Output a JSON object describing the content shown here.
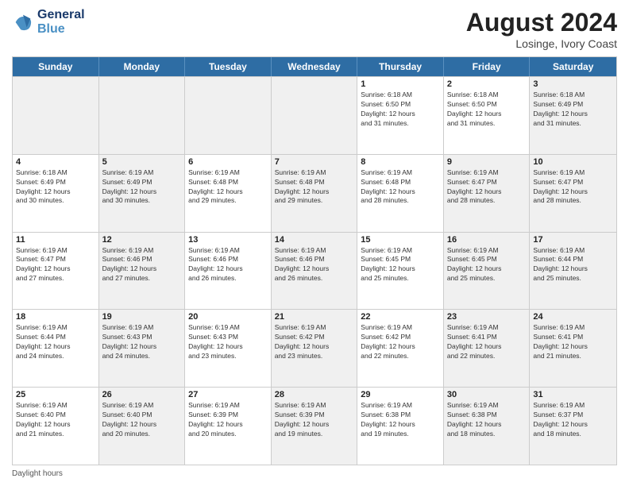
{
  "header": {
    "logo_line1": "General",
    "logo_line2": "Blue",
    "month_year": "August 2024",
    "location": "Losinge, Ivory Coast"
  },
  "weekdays": [
    "Sunday",
    "Monday",
    "Tuesday",
    "Wednesday",
    "Thursday",
    "Friday",
    "Saturday"
  ],
  "rows": [
    [
      {
        "day": "",
        "info": "",
        "shaded": true
      },
      {
        "day": "",
        "info": "",
        "shaded": true
      },
      {
        "day": "",
        "info": "",
        "shaded": true
      },
      {
        "day": "",
        "info": "",
        "shaded": true
      },
      {
        "day": "1",
        "info": "Sunrise: 6:18 AM\nSunset: 6:50 PM\nDaylight: 12 hours\nand 31 minutes."
      },
      {
        "day": "2",
        "info": "Sunrise: 6:18 AM\nSunset: 6:50 PM\nDaylight: 12 hours\nand 31 minutes."
      },
      {
        "day": "3",
        "info": "Sunrise: 6:18 AM\nSunset: 6:49 PM\nDaylight: 12 hours\nand 31 minutes.",
        "shaded": true
      }
    ],
    [
      {
        "day": "4",
        "info": "Sunrise: 6:18 AM\nSunset: 6:49 PM\nDaylight: 12 hours\nand 30 minutes."
      },
      {
        "day": "5",
        "info": "Sunrise: 6:19 AM\nSunset: 6:49 PM\nDaylight: 12 hours\nand 30 minutes.",
        "shaded": true
      },
      {
        "day": "6",
        "info": "Sunrise: 6:19 AM\nSunset: 6:48 PM\nDaylight: 12 hours\nand 29 minutes."
      },
      {
        "day": "7",
        "info": "Sunrise: 6:19 AM\nSunset: 6:48 PM\nDaylight: 12 hours\nand 29 minutes.",
        "shaded": true
      },
      {
        "day": "8",
        "info": "Sunrise: 6:19 AM\nSunset: 6:48 PM\nDaylight: 12 hours\nand 28 minutes."
      },
      {
        "day": "9",
        "info": "Sunrise: 6:19 AM\nSunset: 6:47 PM\nDaylight: 12 hours\nand 28 minutes.",
        "shaded": true
      },
      {
        "day": "10",
        "info": "Sunrise: 6:19 AM\nSunset: 6:47 PM\nDaylight: 12 hours\nand 28 minutes.",
        "shaded": true
      }
    ],
    [
      {
        "day": "11",
        "info": "Sunrise: 6:19 AM\nSunset: 6:47 PM\nDaylight: 12 hours\nand 27 minutes."
      },
      {
        "day": "12",
        "info": "Sunrise: 6:19 AM\nSunset: 6:46 PM\nDaylight: 12 hours\nand 27 minutes.",
        "shaded": true
      },
      {
        "day": "13",
        "info": "Sunrise: 6:19 AM\nSunset: 6:46 PM\nDaylight: 12 hours\nand 26 minutes."
      },
      {
        "day": "14",
        "info": "Sunrise: 6:19 AM\nSunset: 6:46 PM\nDaylight: 12 hours\nand 26 minutes.",
        "shaded": true
      },
      {
        "day": "15",
        "info": "Sunrise: 6:19 AM\nSunset: 6:45 PM\nDaylight: 12 hours\nand 25 minutes."
      },
      {
        "day": "16",
        "info": "Sunrise: 6:19 AM\nSunset: 6:45 PM\nDaylight: 12 hours\nand 25 minutes.",
        "shaded": true
      },
      {
        "day": "17",
        "info": "Sunrise: 6:19 AM\nSunset: 6:44 PM\nDaylight: 12 hours\nand 25 minutes.",
        "shaded": true
      }
    ],
    [
      {
        "day": "18",
        "info": "Sunrise: 6:19 AM\nSunset: 6:44 PM\nDaylight: 12 hours\nand 24 minutes."
      },
      {
        "day": "19",
        "info": "Sunrise: 6:19 AM\nSunset: 6:43 PM\nDaylight: 12 hours\nand 24 minutes.",
        "shaded": true
      },
      {
        "day": "20",
        "info": "Sunrise: 6:19 AM\nSunset: 6:43 PM\nDaylight: 12 hours\nand 23 minutes."
      },
      {
        "day": "21",
        "info": "Sunrise: 6:19 AM\nSunset: 6:42 PM\nDaylight: 12 hours\nand 23 minutes.",
        "shaded": true
      },
      {
        "day": "22",
        "info": "Sunrise: 6:19 AM\nSunset: 6:42 PM\nDaylight: 12 hours\nand 22 minutes."
      },
      {
        "day": "23",
        "info": "Sunrise: 6:19 AM\nSunset: 6:41 PM\nDaylight: 12 hours\nand 22 minutes.",
        "shaded": true
      },
      {
        "day": "24",
        "info": "Sunrise: 6:19 AM\nSunset: 6:41 PM\nDaylight: 12 hours\nand 21 minutes.",
        "shaded": true
      }
    ],
    [
      {
        "day": "25",
        "info": "Sunrise: 6:19 AM\nSunset: 6:40 PM\nDaylight: 12 hours\nand 21 minutes."
      },
      {
        "day": "26",
        "info": "Sunrise: 6:19 AM\nSunset: 6:40 PM\nDaylight: 12 hours\nand 20 minutes.",
        "shaded": true
      },
      {
        "day": "27",
        "info": "Sunrise: 6:19 AM\nSunset: 6:39 PM\nDaylight: 12 hours\nand 20 minutes."
      },
      {
        "day": "28",
        "info": "Sunrise: 6:19 AM\nSunset: 6:39 PM\nDaylight: 12 hours\nand 19 minutes.",
        "shaded": true
      },
      {
        "day": "29",
        "info": "Sunrise: 6:19 AM\nSunset: 6:38 PM\nDaylight: 12 hours\nand 19 minutes."
      },
      {
        "day": "30",
        "info": "Sunrise: 6:19 AM\nSunset: 6:38 PM\nDaylight: 12 hours\nand 18 minutes.",
        "shaded": true
      },
      {
        "day": "31",
        "info": "Sunrise: 6:19 AM\nSunset: 6:37 PM\nDaylight: 12 hours\nand 18 minutes.",
        "shaded": true
      }
    ]
  ],
  "footer": "Daylight hours"
}
